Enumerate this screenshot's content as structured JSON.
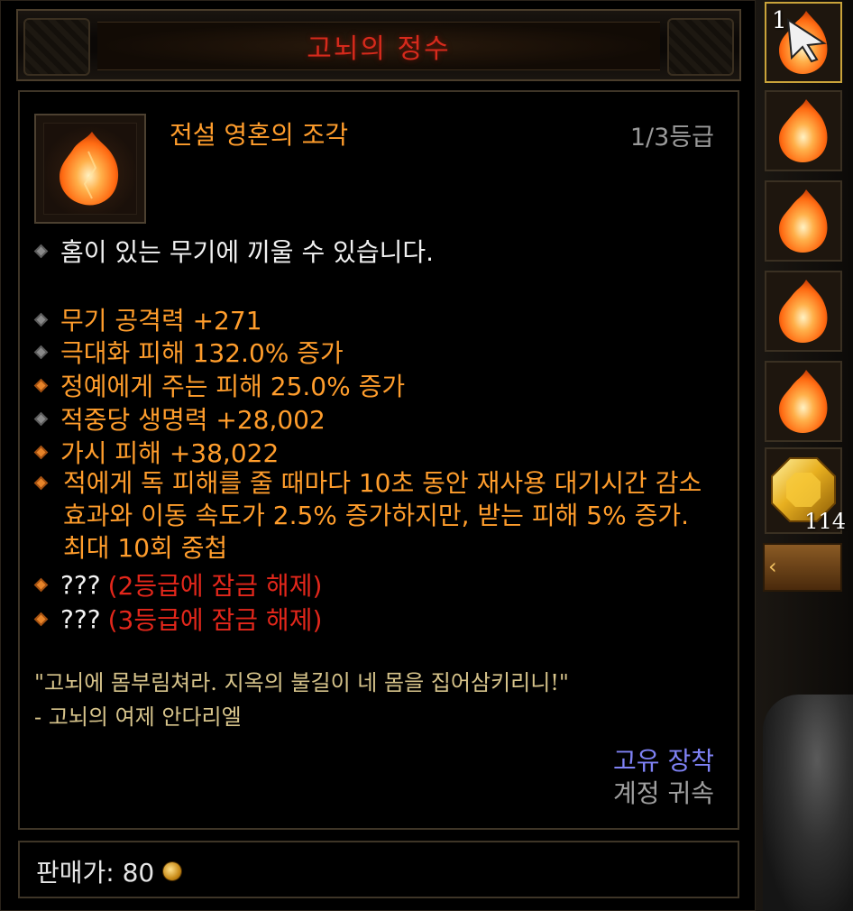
{
  "item": {
    "name": "고뇌의 정수",
    "type": "전설 영혼의 조각",
    "rank": "1/3등급"
  },
  "properties": {
    "socket": "홈이 있는 무기에 끼울 수 있습니다.",
    "stats": [
      {
        "text": "무기 공격력 +271",
        "bullet": "grey"
      },
      {
        "text": "극대화 피해 132.0% 증가",
        "bullet": "grey"
      },
      {
        "text": "정예에게 주는 피해 25.0% 증가",
        "bullet": "orange"
      },
      {
        "text": "적중당 생명력 +28,002",
        "bullet": "grey"
      },
      {
        "text": "가시 피해 +38,022",
        "bullet": "orange"
      }
    ],
    "long_effect": "적에게 독 피해를 줄 때마다 10초 동안 재사용 대기시간 감소 효과와 이동 속도가 2.5% 증가하지만, 받는 피해 5% 증가. 최대 10회 중첩",
    "locked": [
      {
        "prefix": "???",
        "text": "(2등급에 잠금 해제)"
      },
      {
        "prefix": "???",
        "text": "(3등급에 잠금 해제)"
      }
    ]
  },
  "flavor": {
    "quote": "\"고뇌에 몸부림쳐라. 지옥의 불길이 네 몸을 집어삼키리니!\"",
    "author": "- 고뇌의 여제 안다리엘"
  },
  "binding": {
    "unique": "고유 장착",
    "account": "계정 귀속"
  },
  "sell": {
    "label": "판매가: 80"
  },
  "inventory": {
    "stack_count": "1",
    "gem_count": "114",
    "slot_icons": [
      "flame-shard-icon",
      "flame-shard-icon",
      "flame-shard-icon",
      "flame-shard-icon",
      "flame-shard-icon",
      "gem-icon"
    ]
  },
  "colors": {
    "legendary_orange": "#ff9d2c",
    "title_red": "#d62a1c",
    "locked_red": "#e3271b",
    "unique_blue": "#7f82f5",
    "flavor_gold": "#d7c48b"
  }
}
